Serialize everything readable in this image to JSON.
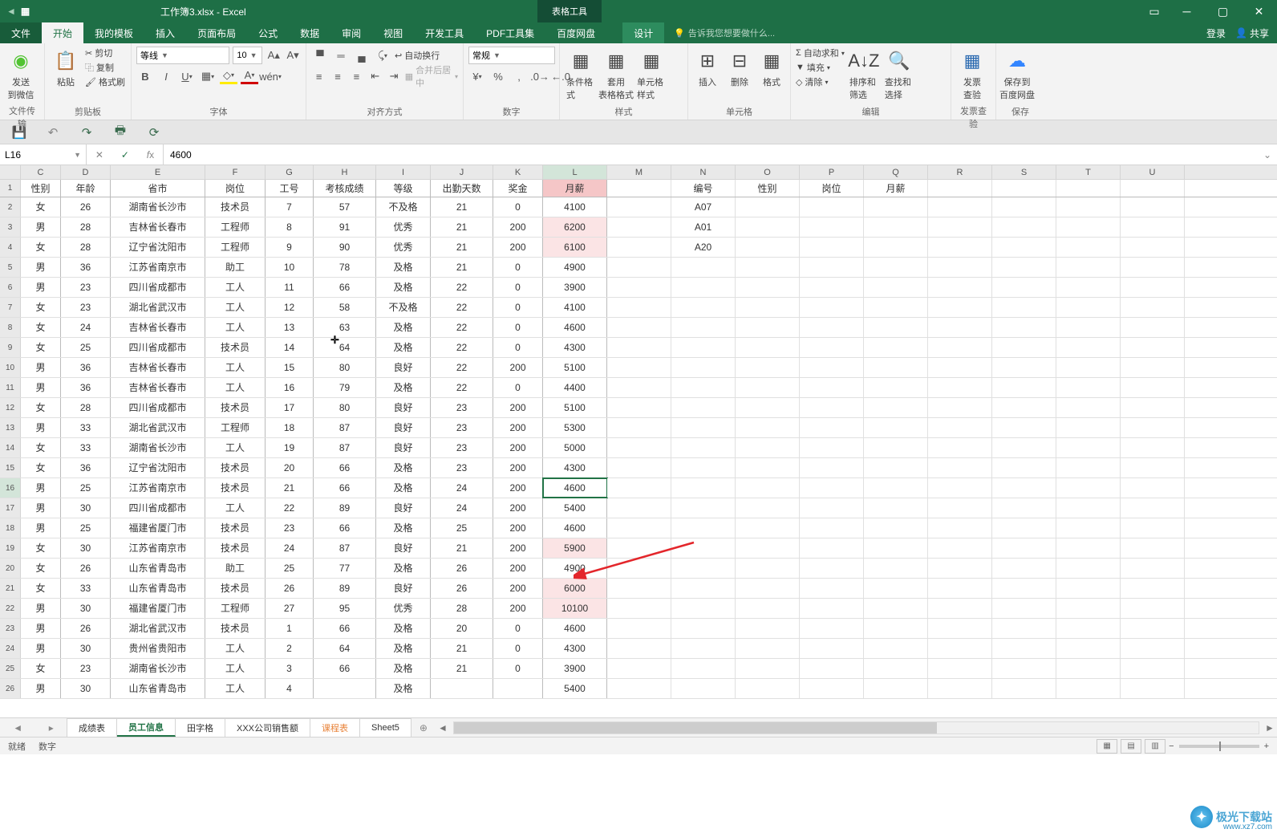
{
  "title_doc": "工作簿3.xlsx - Excel",
  "table_tools": "表格工具",
  "menu": {
    "file": "文件",
    "home": "开始",
    "mytemplates": "我的模板",
    "insert": "插入",
    "pagelayout": "页面布局",
    "formulas": "公式",
    "data": "数据",
    "review": "审阅",
    "view": "视图",
    "developer": "开发工具",
    "pdf": "PDF工具集",
    "baidu": "百度网盘",
    "design": "设计",
    "tellme": "告诉我您想要做什么...",
    "login": "登录",
    "share": "共享"
  },
  "ribbon": {
    "send_wechat": "发送\n到微信",
    "paste": "粘贴",
    "cut": "剪切",
    "copy": "复制",
    "formatpainter": "格式刷",
    "g1": "文件传输",
    "g2": "剪贴板",
    "g3": "字体",
    "g4": "对齐方式",
    "g5": "数字",
    "g6": "样式",
    "g7": "单元格",
    "g8": "编辑",
    "g9": "发票查验",
    "g10": "保存",
    "font_name": "等线",
    "font_size": "10",
    "wrap": "自动换行",
    "merge": "合并后居中",
    "num_format": "常规",
    "cond_fmt": "条件格式",
    "table_fmt": "套用\n表格格式",
    "cell_style": "单元格样式",
    "ins": "插入",
    "del": "删除",
    "fmt": "格式",
    "autosum": "自动求和",
    "fill": "填充",
    "clear": "清除",
    "sort": "排序和筛选",
    "find": "查找和选择",
    "invoice": "发票\n查验",
    "save_baidu": "保存到\n百度网盘"
  },
  "namebox": "L16",
  "formula": "4600",
  "cols": [
    "C",
    "D",
    "E",
    "F",
    "G",
    "H",
    "I",
    "J",
    "K",
    "L",
    "M",
    "N",
    "O",
    "P",
    "Q",
    "R",
    "S",
    "T",
    "U"
  ],
  "header_row": [
    "性别",
    "年龄",
    "省市",
    "岗位",
    "工号",
    "考核成绩",
    "等级",
    "出勤天数",
    "奖金",
    "月薪",
    "",
    "编号",
    "性别",
    "岗位",
    "月薪"
  ],
  "side_rows": [
    [
      "A07",
      "",
      "",
      ""
    ],
    [
      "A01",
      "",
      "",
      ""
    ],
    [
      "A20",
      "",
      "",
      ""
    ]
  ],
  "rows": [
    [
      "女",
      "26",
      "湖南省长沙市",
      "技术员",
      "7",
      "57",
      "不及格",
      "21",
      "0",
      "4100"
    ],
    [
      "男",
      "28",
      "吉林省长春市",
      "工程师",
      "8",
      "91",
      "优秀",
      "21",
      "200",
      "6200"
    ],
    [
      "女",
      "28",
      "辽宁省沈阳市",
      "工程师",
      "9",
      "90",
      "优秀",
      "21",
      "200",
      "6100"
    ],
    [
      "男",
      "36",
      "江苏省南京市",
      "助工",
      "10",
      "78",
      "及格",
      "21",
      "0",
      "4900"
    ],
    [
      "男",
      "23",
      "四川省成都市",
      "工人",
      "11",
      "66",
      "及格",
      "22",
      "0",
      "3900"
    ],
    [
      "女",
      "23",
      "湖北省武汉市",
      "工人",
      "12",
      "58",
      "不及格",
      "22",
      "0",
      "4100"
    ],
    [
      "女",
      "24",
      "吉林省长春市",
      "工人",
      "13",
      "63",
      "及格",
      "22",
      "0",
      "4600"
    ],
    [
      "女",
      "25",
      "四川省成都市",
      "技术员",
      "14",
      "64",
      "及格",
      "22",
      "0",
      "4300"
    ],
    [
      "男",
      "36",
      "吉林省长春市",
      "工人",
      "15",
      "80",
      "良好",
      "22",
      "200",
      "5100"
    ],
    [
      "男",
      "36",
      "吉林省长春市",
      "工人",
      "16",
      "79",
      "及格",
      "22",
      "0",
      "4400"
    ],
    [
      "女",
      "28",
      "四川省成都市",
      "技术员",
      "17",
      "80",
      "良好",
      "23",
      "200",
      "5100"
    ],
    [
      "男",
      "33",
      "湖北省武汉市",
      "工程师",
      "18",
      "87",
      "良好",
      "23",
      "200",
      "5300"
    ],
    [
      "女",
      "33",
      "湖南省长沙市",
      "工人",
      "19",
      "87",
      "良好",
      "23",
      "200",
      "5000"
    ],
    [
      "女",
      "36",
      "辽宁省沈阳市",
      "技术员",
      "20",
      "66",
      "及格",
      "23",
      "200",
      "4300"
    ],
    [
      "男",
      "25",
      "江苏省南京市",
      "技术员",
      "21",
      "66",
      "及格",
      "24",
      "200",
      "4600"
    ],
    [
      "男",
      "30",
      "四川省成都市",
      "工人",
      "22",
      "89",
      "良好",
      "24",
      "200",
      "5400"
    ],
    [
      "男",
      "25",
      "福建省厦门市",
      "技术员",
      "23",
      "66",
      "及格",
      "25",
      "200",
      "4600"
    ],
    [
      "女",
      "30",
      "江苏省南京市",
      "技术员",
      "24",
      "87",
      "良好",
      "21",
      "200",
      "5900"
    ],
    [
      "女",
      "26",
      "山东省青岛市",
      "助工",
      "25",
      "77",
      "及格",
      "26",
      "200",
      "4900"
    ],
    [
      "女",
      "33",
      "山东省青岛市",
      "技术员",
      "26",
      "89",
      "良好",
      "26",
      "200",
      "6000"
    ],
    [
      "男",
      "30",
      "福建省厦门市",
      "工程师",
      "27",
      "95",
      "优秀",
      "28",
      "200",
      "10100"
    ],
    [
      "男",
      "26",
      "湖北省武汉市",
      "技术员",
      "1",
      "66",
      "及格",
      "20",
      "0",
      "4600"
    ],
    [
      "男",
      "30",
      "贵州省贵阳市",
      "工人",
      "2",
      "64",
      "及格",
      "21",
      "0",
      "4300"
    ],
    [
      "女",
      "23",
      "湖南省长沙市",
      "工人",
      "3",
      "66",
      "及格",
      "21",
      "0",
      "3900"
    ],
    [
      "男",
      "30",
      "山东省青岛市",
      "工人",
      "4",
      "",
      "及格",
      "",
      "",
      "5400"
    ]
  ],
  "highlight_rows": {
    "1": "hl2",
    "2": "hl2",
    "17": "hl2",
    "19": "hl2",
    "20": "hl2"
  },
  "sel_row": 15,
  "sheets": {
    "s1": "成绩表",
    "s2": "员工信息",
    "s3": "田字格",
    "s4": "XXX公司销售额",
    "s5": "课程表",
    "s6": "Sheet5"
  },
  "status": {
    "ready": "就绪",
    "mode": "数字"
  },
  "watermark": "极光下载站",
  "wm2": "www.xz7.com"
}
